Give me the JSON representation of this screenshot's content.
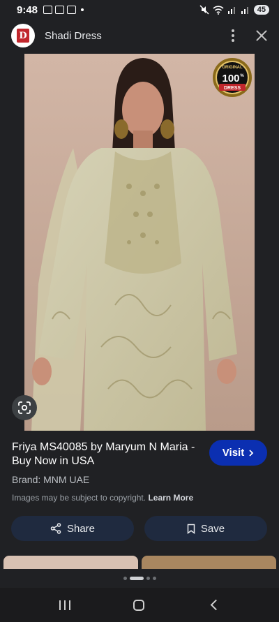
{
  "status_bar": {
    "time": "9:48",
    "battery": "45"
  },
  "header": {
    "site_name": "Shadi Dress",
    "logo_letter": "D"
  },
  "image": {
    "badge_top": "ORIGINAL",
    "badge_number": "100",
    "badge_percent": "%",
    "badge_bottom": "DRESS"
  },
  "result": {
    "title": "Friya MS40085 by Maryum N Maria - Buy Now in USA",
    "visit_label": "Visit",
    "brand": "Brand: MNM UAE",
    "copyright_text": "Images may be subject to copyright.",
    "learn_more": "Learn More"
  },
  "actions": {
    "share_label": "Share",
    "save_label": "Save"
  },
  "colors": {
    "accent": "#0b2fb1",
    "background": "#202124",
    "action_button_bg": "#1f2a3f"
  }
}
